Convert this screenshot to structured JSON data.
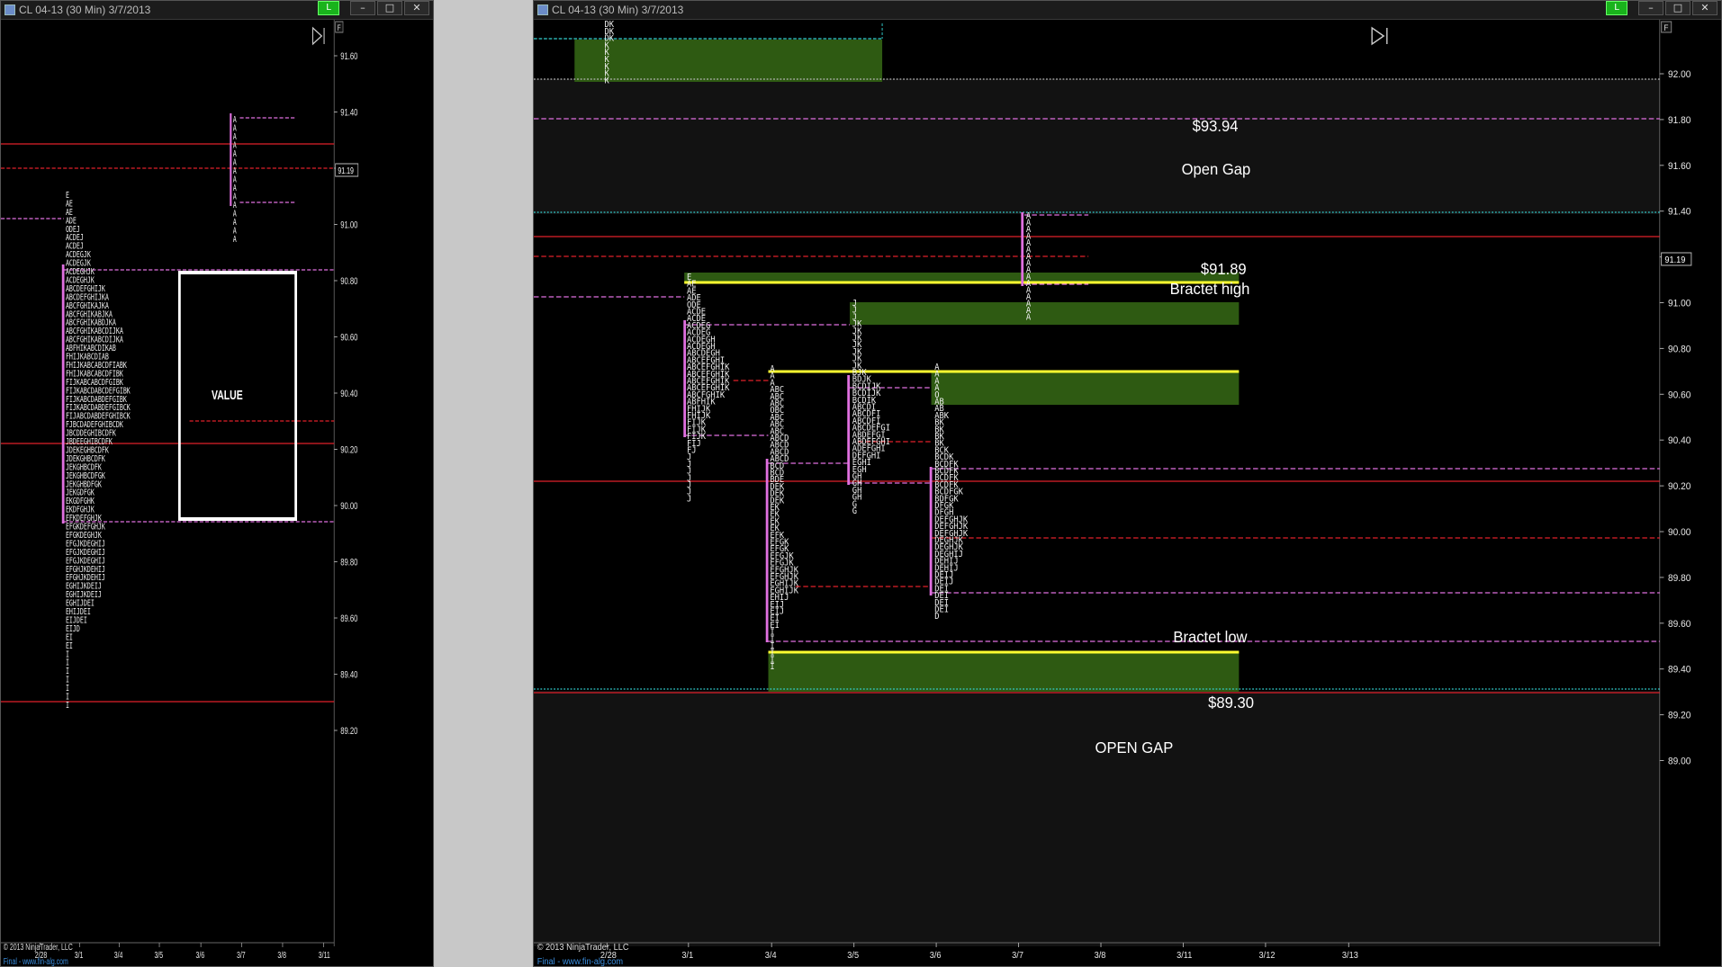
{
  "left_window": {
    "title": "CL 04-13 (30 Min)  3/7/2013",
    "controls": {
      "status": "L",
      "minimize": "–",
      "maximize": "□",
      "close": "✕"
    },
    "button_f": "F",
    "play_icon": "skip-to-end-icon",
    "price_labels": [
      "91.60",
      "91.40",
      "91.20",
      "91.00",
      "90.80",
      "90.60",
      "90.40",
      "90.20",
      "90.00",
      "89.80",
      "89.60",
      "89.40",
      "89.20"
    ],
    "last_price": "91.19",
    "date_labels": [
      "2/28",
      "3/1",
      "3/4",
      "3/5",
      "3/6",
      "3/7",
      "3/8",
      "3/11"
    ],
    "value_label": "VALUE",
    "copyright": "© 2013 NinjaTrader, LLC",
    "credit": "Final - www.fin-alg.com",
    "profile_rows": [
      "E",
      "AE",
      "AE",
      "ADE",
      "ODEJ",
      "ACDEJ",
      "ACDEJ",
      "ACDEGJK",
      "ACDEGJK",
      "ACDEGHJK",
      "ACDEGHJK",
      "ABCDEFGHIJK",
      "ABCDEFGHIJKA",
      "ABCFGHIKAJKA",
      "ABCFGHIKABJKA",
      "ABCFGHIKABDJKA",
      "ABCFGHIKABCDIJKA",
      "ABCFGHIKABCDIJKA",
      "ABFHIKABCDIKAB",
      "FHIJKABCDIAB",
      "FHIJKABCABCDFIABK",
      "FHIJKABCABCDFIBK",
      "FIJKABCABCDFGIBK",
      "FIJKABCDABCDEFGIBK",
      "FIJKABCDABDEFGIBK",
      "FIJKABCDABDEFGIBCK",
      "FIJABCDABDEFGHIBCK",
      "FJBCDADEFGHIBCDK",
      "JBCDDEGHIBCDFK",
      "JBDEEGHIBCDFK",
      "JDEKEGHBCDFK",
      "JDEKGHBCDFK",
      "JEKGHBCDFK",
      "JEKGHBCDFGK",
      "JEKGHBDFGK",
      "JEKGDFGK",
      "EKGDFGHK",
      "EKDFGHJK",
      "EFKDEFGHJK",
      "EFGKDEFGHJK",
      "EFGKDEGHJK",
      "EFGJKDEGHIJ",
      "EFGJKDEGHIJ",
      "EFGJKDEGHIJ",
      "EFGHJKDEHIJ",
      "EFGHJKDEHIJ",
      "EGHIJKDEIJ",
      "EGHIJKDEIJ",
      "EGHIJDEI",
      "EHIJDEI",
      "EIJDEI",
      "EIJD",
      "EI",
      "EI",
      "I",
      "I",
      "I",
      "I",
      "I",
      "I",
      "I"
    ],
    "profile_right": [
      "A",
      "A",
      "A",
      "A",
      "A",
      "A",
      "A",
      "A",
      "A",
      "A",
      "A",
      "A",
      "A",
      "A",
      "A"
    ]
  },
  "right_window": {
    "title": "CL 04-13 (30 Min)  3/7/2013",
    "controls": {
      "status": "L",
      "minimize": "–",
      "maximize": "□",
      "close": "✕"
    },
    "button_f": "F",
    "play_icon": "skip-to-end-icon",
    "price_labels": [
      "92.00",
      "91.80",
      "91.60",
      "91.40",
      "91.20",
      "91.00",
      "90.80",
      "90.60",
      "90.40",
      "90.20",
      "90.00",
      "89.80",
      "89.60",
      "89.40",
      "89.20",
      "89.00"
    ],
    "last_price": "91.19",
    "date_labels": [
      "2/28",
      "3/1",
      "3/4",
      "3/5",
      "3/6",
      "3/7",
      "3/8",
      "3/11",
      "3/12",
      "3/13"
    ],
    "annotations": {
      "price_high": "$93.94",
      "open_gap_top": "Open Gap",
      "price_mid": "$91.89",
      "bracket_high": "Bractet high",
      "bracket_low": "Bractet low",
      "price_low": "$89.30",
      "open_gap_bottom": "OPEN GAP"
    },
    "copyright": "© 2013 NinjaTrader, LLC",
    "credit": "Final - www.fin-alg.com",
    "profiles": {
      "top_left": [
        "DK",
        "DK",
        "DK",
        "K",
        "K",
        "K",
        "K",
        "K",
        "K"
      ],
      "p_3_1": [
        "E",
        "AE",
        "AE",
        "ADE",
        "ODE",
        "ACDE",
        "ACDE",
        "ACDEG",
        "ACDEG",
        "ACDEGH",
        "ACDEGH",
        "ABCDEGH",
        "ABCEFGHI",
        "ABCEFGHIK",
        "ABCEFGHIK",
        "ABCEFGHIK",
        "ABCEFGHIK",
        "ABCFGHIK",
        "ABFHIK",
        "FHIJK",
        "FHIJK",
        "FIJK",
        "FIJK",
        "FIJK",
        "FIJ",
        "FJ",
        "J",
        "J",
        "J",
        "J",
        "J",
        "J",
        "J"
      ],
      "p_3_4": [
        "A",
        "A",
        "A",
        "ABC",
        "ABC",
        "ABC",
        "OBC",
        "ABC",
        "ABC",
        "ABC",
        "ABCD",
        "ABCD",
        "ABCD",
        "ABCD",
        "BCD",
        "BCD",
        "BDE",
        "DEK",
        "DEK",
        "DEK",
        "EK",
        "EK",
        "EK",
        "EK",
        "EFK",
        "EFGK",
        "EFGK",
        "EFGJK",
        "EFGJK",
        "EFGHJK",
        "EFGHJK",
        "EGHIJK",
        "EGHIJK",
        "EHIJ",
        "EIJ",
        "EIJ",
        "EI",
        "EI",
        "I",
        "I",
        "I",
        "I",
        "I",
        "I"
      ],
      "p_3_5": [
        "J",
        "J",
        "J",
        "JK",
        "JK",
        "JK",
        "JK",
        "JK",
        "JK",
        "JK",
        "BJK",
        "BDJK",
        "BCDIJK",
        "BCDIJK",
        "BCDIK",
        "ABCDI",
        "ABCDFI",
        "ABCDFI",
        "ABCDEFGI",
        "ABDEFGI",
        "ABDEFGHI",
        "ADEFGHI",
        "DEFGHI",
        "EGHI",
        "EGH",
        "GH",
        "GH",
        "GH",
        "GH",
        "G",
        "G"
      ],
      "p_3_6": [
        "A",
        "A",
        "A",
        "A",
        "O",
        "AB",
        "AB",
        "ABK",
        "BK",
        "BK",
        "BK",
        "BK",
        "BCK",
        "BCDK",
        "BCDFK",
        "BCDFK",
        "BCDFK",
        "BCDFK",
        "BCDFGK",
        "BDFGK",
        "DFGK",
        "DFGH",
        "DEFGHJK",
        "DEFGHJK",
        "DEFGHJK",
        "DEGHJK",
        "DEGHJK",
        "DEGHIJ",
        "DEHIJ",
        "DEHIJ",
        "DEIJ",
        "DEIJ",
        "DEI",
        "DEI",
        "DEI",
        "DEI",
        "D"
      ],
      "p_3_7": [
        "A",
        "A",
        "A",
        "A",
        "A",
        "A",
        "A",
        "A",
        "A",
        "A",
        "A",
        "A",
        "A",
        "A",
        "A",
        "A"
      ]
    }
  }
}
